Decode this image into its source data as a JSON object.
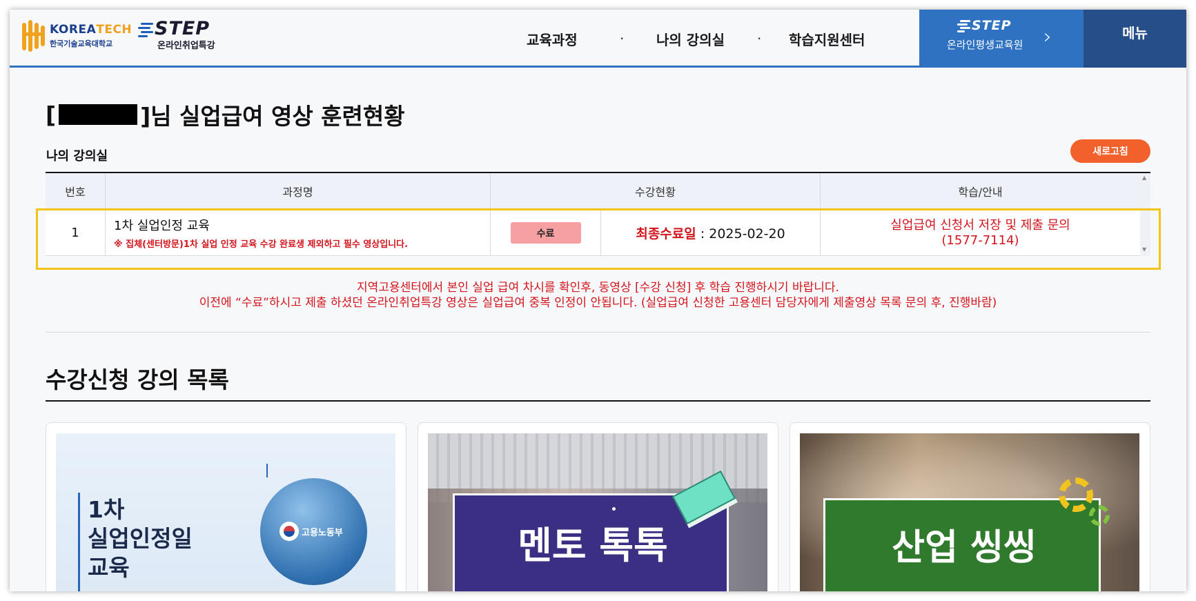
{
  "header": {
    "koreatech_en_a": "KOREA",
    "koreatech_en_b": "TECH",
    "koreatech_ko": "한국기술교육대학교",
    "step_word": "STEP",
    "step_sub": "온라인취업특강",
    "nav": [
      "교육과정",
      "나의 강의실",
      "학습지원센터"
    ],
    "nav_separator": "·",
    "step_btn_word": "STEP",
    "step_btn_sub": "온라인평생교육원",
    "step_btn_arrow": "›",
    "menu": "메뉴",
    "accent_color": "#2f72c2"
  },
  "page": {
    "title_open": "[",
    "title_rest": "]님 실업급여 영상 훈련현황",
    "section_label": "나의 강의실",
    "refresh": "새로고침"
  },
  "table": {
    "headers": [
      "번호",
      "과정명",
      "수강현황",
      "학습/안내"
    ],
    "rows": [
      {
        "no": "1",
        "course": "1차 실업인정 교육",
        "note": "※ 집체(센터방문)1차 실업 인정 교육 수강 완료생 제외하고 필수 영상입니다.",
        "status": "수료",
        "last_label": "최종수료일",
        "last_sep": " : ",
        "last_date": "2025-02-20",
        "guide_line1": "실업급여 신청서 저장 및 제출 문의",
        "guide_line2": "(1577-7114)"
      }
    ]
  },
  "notice": {
    "line1": "지역고용센터에서 본인 실업 급여 차시를 확인후, 동영상 [수강 신청] 후 학습 진행하시기 바랍니다.",
    "line2": "이전에 “수료”하시고 제출 하셨던 온라인취업특강 영상은 실업급여 중복 인정이 안됩니다. (실업급여 신청한 고용센터 담당자에게 제출영상 목록 문의 후, 진행바람)"
  },
  "list": {
    "title": "수강신청 강의 목록",
    "cards": [
      {
        "line1": "1차",
        "line2": "실업인정일",
        "line3": "교육",
        "badge": "고용노동부"
      },
      {
        "text": "멘토 톡톡"
      },
      {
        "text": "산업 씽씽"
      }
    ]
  }
}
